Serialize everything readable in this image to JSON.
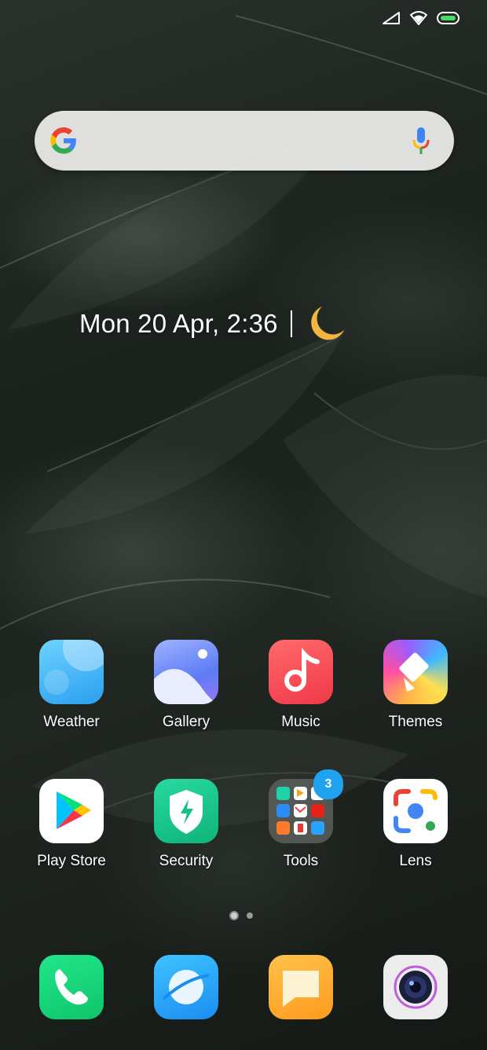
{
  "status_bar": {
    "icons": [
      "signal-icon",
      "wifi-icon",
      "battery-icon"
    ]
  },
  "search": {
    "logo": "google-g-icon",
    "mic": "microphone-icon",
    "placeholder": ""
  },
  "clock_widget": {
    "datetime": "Mon 20 Apr, 2:36",
    "weather_icon": "crescent-moon-icon"
  },
  "apps": [
    {
      "label": "Weather",
      "icon": "weather-icon"
    },
    {
      "label": "Gallery",
      "icon": "gallery-icon"
    },
    {
      "label": "Music",
      "icon": "music-note-icon"
    },
    {
      "label": "Themes",
      "icon": "themes-brush-icon"
    },
    {
      "label": "Play Store",
      "icon": "play-store-icon"
    },
    {
      "label": "Security",
      "icon": "security-shield-icon"
    },
    {
      "label": "Tools",
      "icon": "folder-icon",
      "badge": "3"
    },
    {
      "label": "Lens",
      "icon": "lens-icon"
    }
  ],
  "pager": {
    "pages": 2,
    "current": 1
  },
  "dock": [
    {
      "name": "phone",
      "icon": "phone-icon"
    },
    {
      "name": "browser",
      "icon": "browser-icon"
    },
    {
      "name": "messages",
      "icon": "messages-icon"
    },
    {
      "name": "camera",
      "icon": "camera-icon"
    }
  ],
  "colors": {
    "moon": "#F3B440",
    "badge": "#1FA3F0"
  }
}
